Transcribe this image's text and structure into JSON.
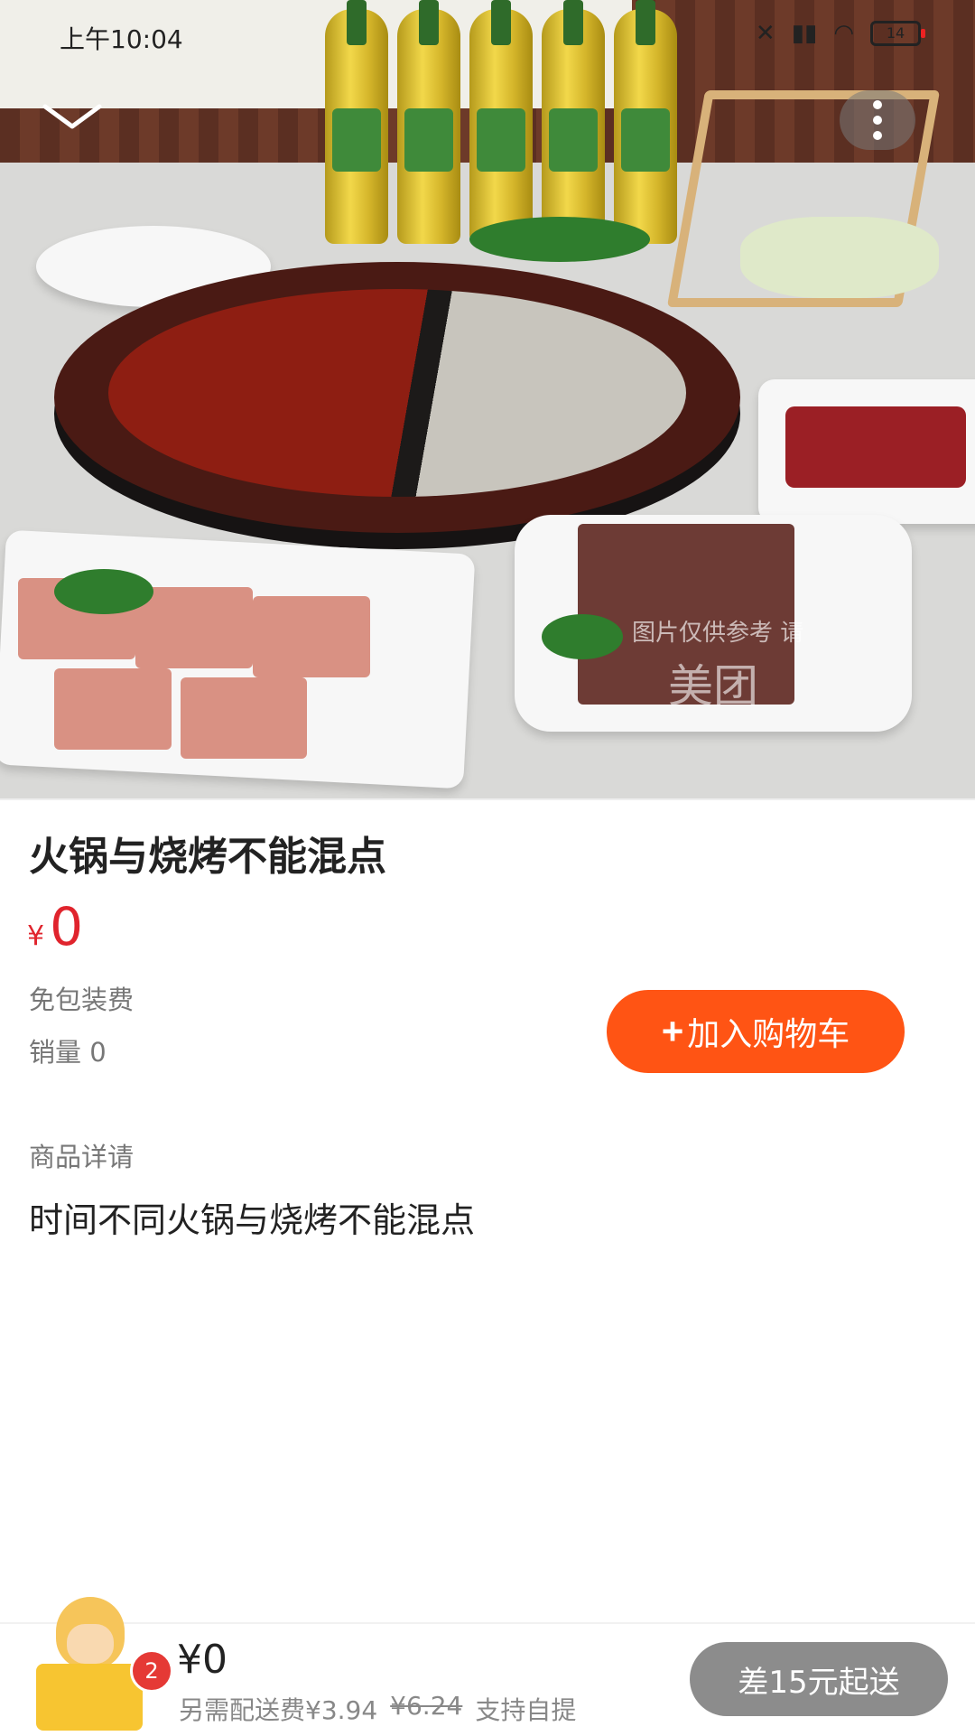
{
  "status_bar": {
    "time": "上午10:04",
    "indicators": [
      "bluetooth-off-icon",
      "signal-icon",
      "wifi-icon"
    ],
    "battery": "14"
  },
  "product": {
    "image_watermark_text": "图片仅供参考 请",
    "image_watermark_brand": "美团",
    "name": "火锅与烧烤不能混点",
    "currency_symbol": "¥",
    "price": "0",
    "packaging_note": "免包装费",
    "sales": "销量 0",
    "add_to_cart_label": "+加入购物车",
    "add_to_cart_text": "加入购物车",
    "details_label": "商品详请",
    "details_text": "时间不同火锅与烧烤不能混点"
  },
  "cart": {
    "badge_count": "2",
    "total": "¥0",
    "delivery_fee_note": "另需配送费¥3.94",
    "original_delivery_fee": "¥6.24",
    "pickup_note": "支持自提",
    "checkout_label": "差15元起送"
  },
  "colors": {
    "accent": "#ff5414",
    "price_red": "#e0242d",
    "badge_red": "#e53935",
    "checkout_disabled": "#8c8c8c"
  }
}
